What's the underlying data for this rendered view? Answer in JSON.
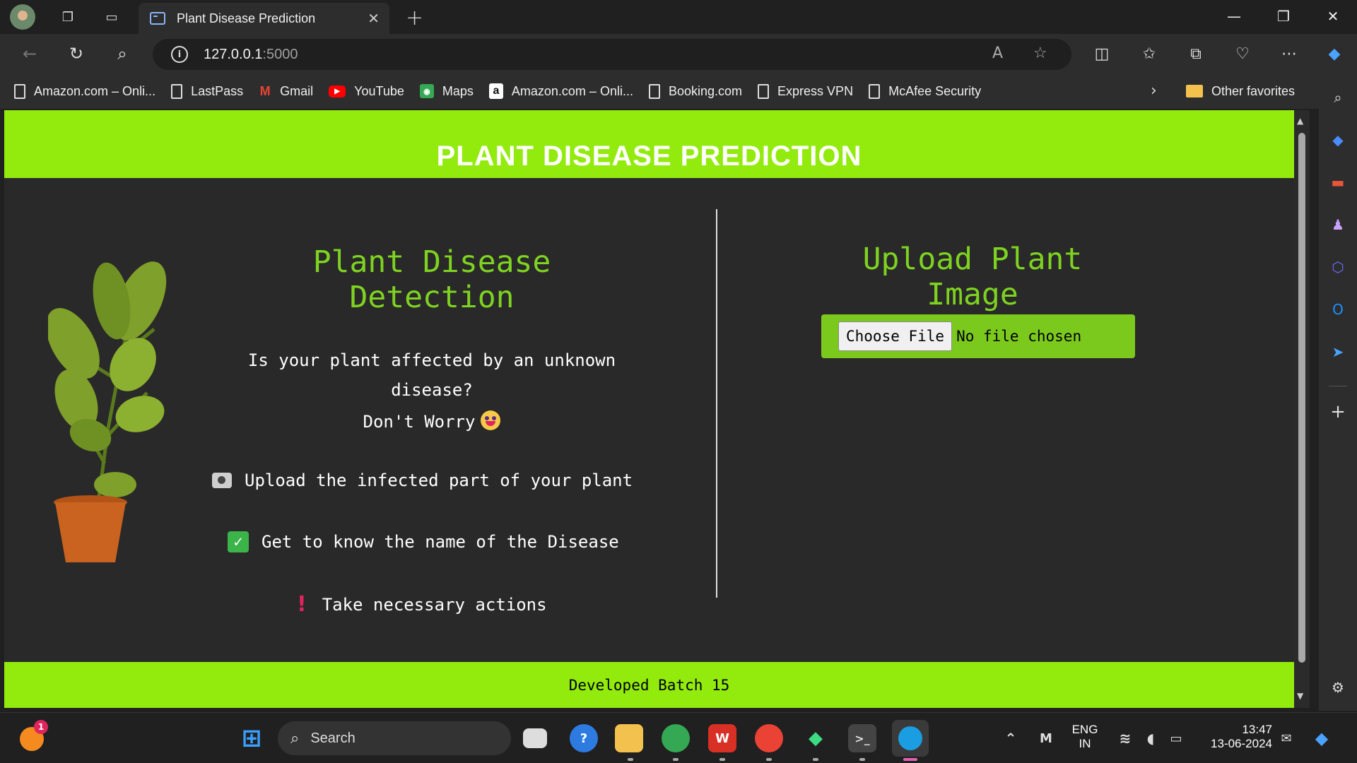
{
  "browser": {
    "tab_title": "Plant Disease Prediction",
    "url_host": "127.0.0.1",
    "url_port": ":5000",
    "bookmarks": [
      {
        "label": "Amazon.com – Onli...",
        "icon": "page-icon"
      },
      {
        "label": "LastPass",
        "icon": "page-icon"
      },
      {
        "label": "Gmail",
        "icon": "gmail-icon"
      },
      {
        "label": "YouTube",
        "icon": "youtube-icon"
      },
      {
        "label": "Maps",
        "icon": "maps-icon"
      },
      {
        "label": "Amazon.com – Onli...",
        "icon": "amazon-icon"
      },
      {
        "label": "Booking.com",
        "icon": "page-icon"
      },
      {
        "label": "Express VPN",
        "icon": "page-icon"
      },
      {
        "label": "McAfee Security",
        "icon": "page-icon"
      }
    ],
    "other_favorites": "Other favorites"
  },
  "page": {
    "header_title": "PLANT DISEASE PREDICTION",
    "left_title": "Plant Disease Detection",
    "question_line1": "Is your plant affected by an unknown",
    "question_line2": "disease?",
    "question_line3": "Don't Worry",
    "step1": "Upload the infected part of your plant",
    "step2": "Get to know the name of the Disease",
    "step3": "Take necessary actions",
    "right_title": "Upload Plant Image",
    "choose_file_label": "Choose File",
    "no_file_label": "No file chosen",
    "footer": "Developed Batch 15",
    "accent_color": "#93eb0e",
    "title_color": "#7ed321"
  },
  "taskbar": {
    "search_label": "Search",
    "notification_badge": "1",
    "lang_line1": "ENG",
    "lang_line2": "IN",
    "time": "13:47",
    "date": "13-06-2024"
  }
}
